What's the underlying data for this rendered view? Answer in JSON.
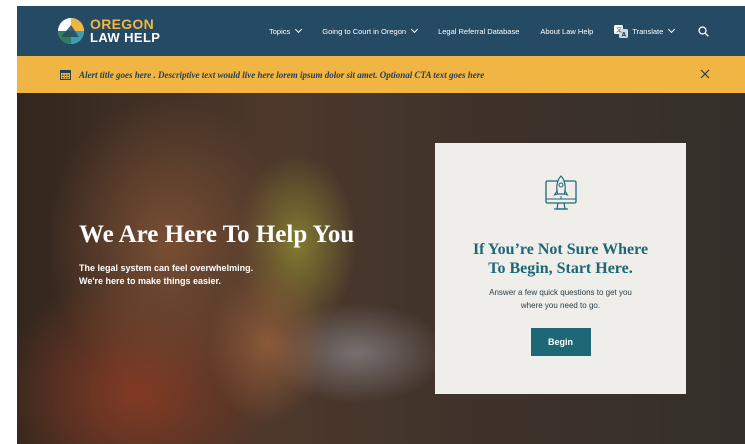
{
  "header": {
    "logo": {
      "line1": "OREGON",
      "line2": "LAW HELP"
    },
    "nav": [
      {
        "label": "Topics",
        "has_dropdown": true
      },
      {
        "label": "Going to Court in Oregon",
        "has_dropdown": true
      },
      {
        "label": "Legal Referral Database",
        "has_dropdown": false
      },
      {
        "label": "About Law Help",
        "has_dropdown": false
      }
    ],
    "translate_label": "Translate",
    "search_icon": "search-icon"
  },
  "alert": {
    "text": "Alert title goes here . Descriptive text would live here lorem ipsum dolor sit amet. Optional CTA text goes here",
    "icon": "calendar-icon",
    "close_icon": "close-icon"
  },
  "hero": {
    "title": "We Are Here To Help You",
    "subtitle_line1": "The legal system can feel overwhelming.",
    "subtitle_line2": "We're here to make things easier."
  },
  "card": {
    "icon": "rocket-monitor-icon",
    "title_line1": "If You’re Not Sure Where",
    "title_line2": "To Begin, Start Here.",
    "text_line1": "Answer a few quick questions to get you",
    "text_line2": "where you need to go.",
    "button_label": "Begin"
  },
  "colors": {
    "header_bg": "#254a63",
    "accent_gold": "#f0b542",
    "teal": "#1e6776",
    "card_bg": "#efeeea"
  }
}
